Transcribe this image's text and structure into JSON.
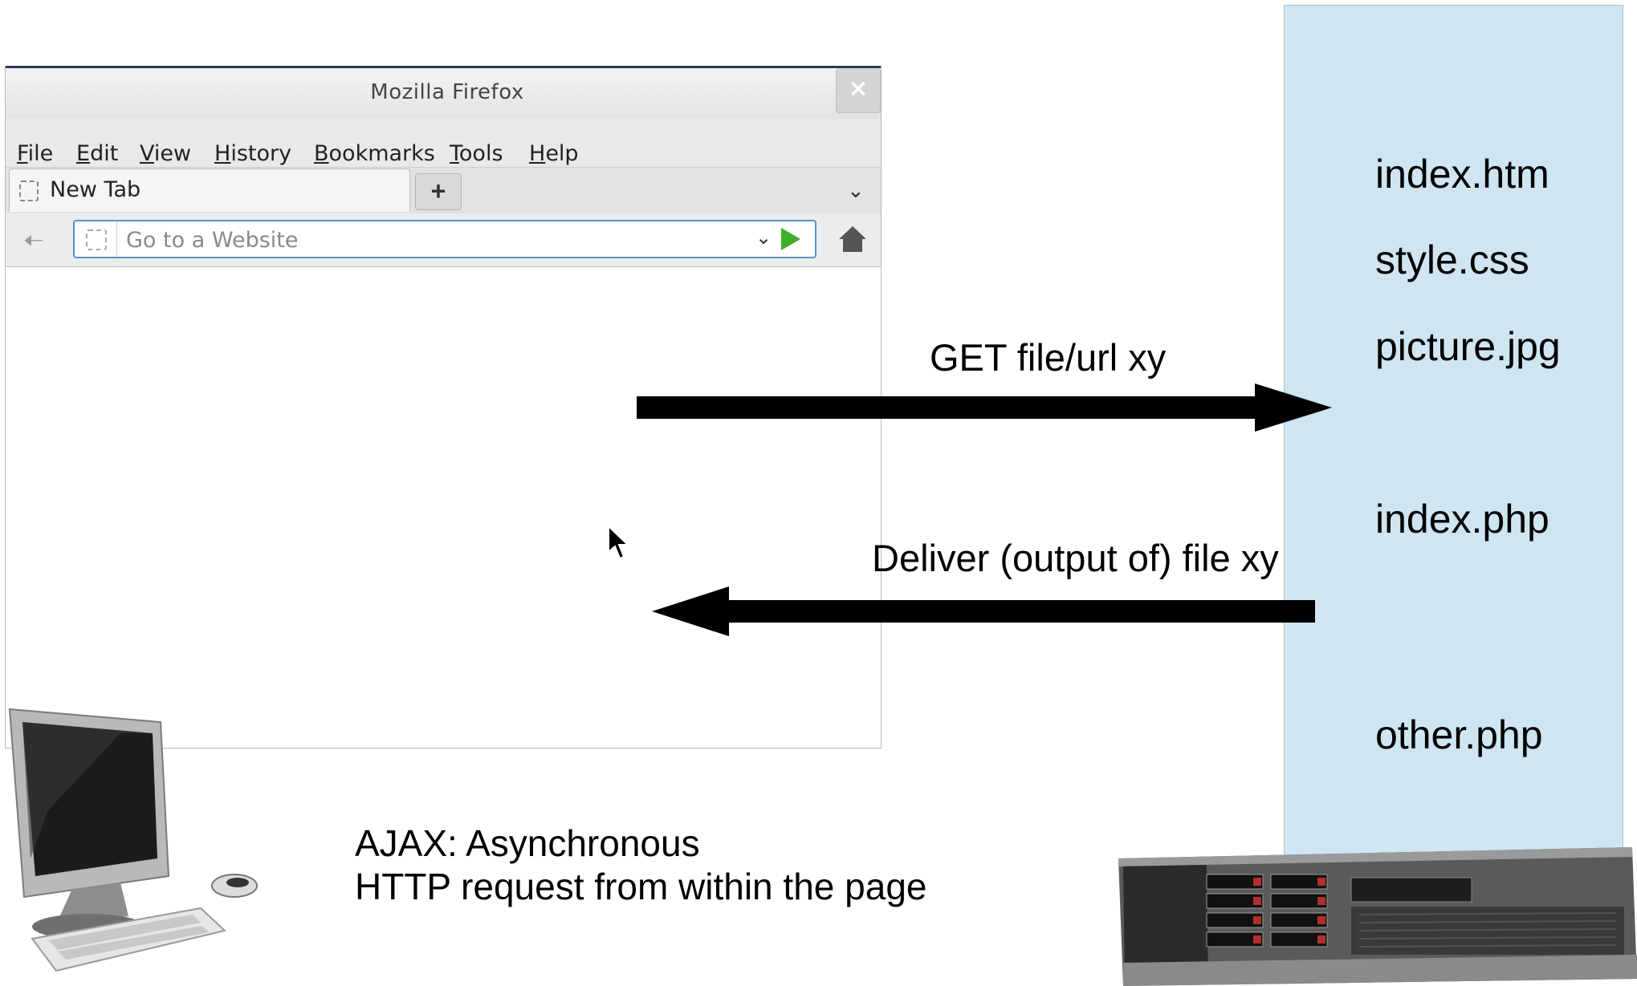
{
  "browser": {
    "title": "Mozilla Firefox",
    "close_label": "×",
    "menu": [
      "File",
      "Edit",
      "View",
      "History",
      "Bookmarks",
      "Tools",
      "Help"
    ],
    "tab_label": "New Tab",
    "newtab_label": "+",
    "url_placeholder": "Go to a Website",
    "icons": {
      "back": "back-arrow-icon",
      "go": "play-arrow-icon",
      "home": "home-icon",
      "dropdown": "chevron-down-icon",
      "cursor": "mouse-pointer-icon"
    }
  },
  "server": {
    "files": [
      "index.htm",
      "style.css",
      "picture.jpg",
      "index.php",
      "other.php"
    ],
    "panel_color": "#d0e5f2"
  },
  "arrows": {
    "request_label": "GET file/url xy",
    "response_label": "Deliver (output of) file xy"
  },
  "caption": {
    "line1": "AJAX: Asynchronous",
    "line2": "HTTP request from within the page"
  },
  "images": {
    "client": "desktop-computer-illustration",
    "server": "rack-server-illustration"
  }
}
